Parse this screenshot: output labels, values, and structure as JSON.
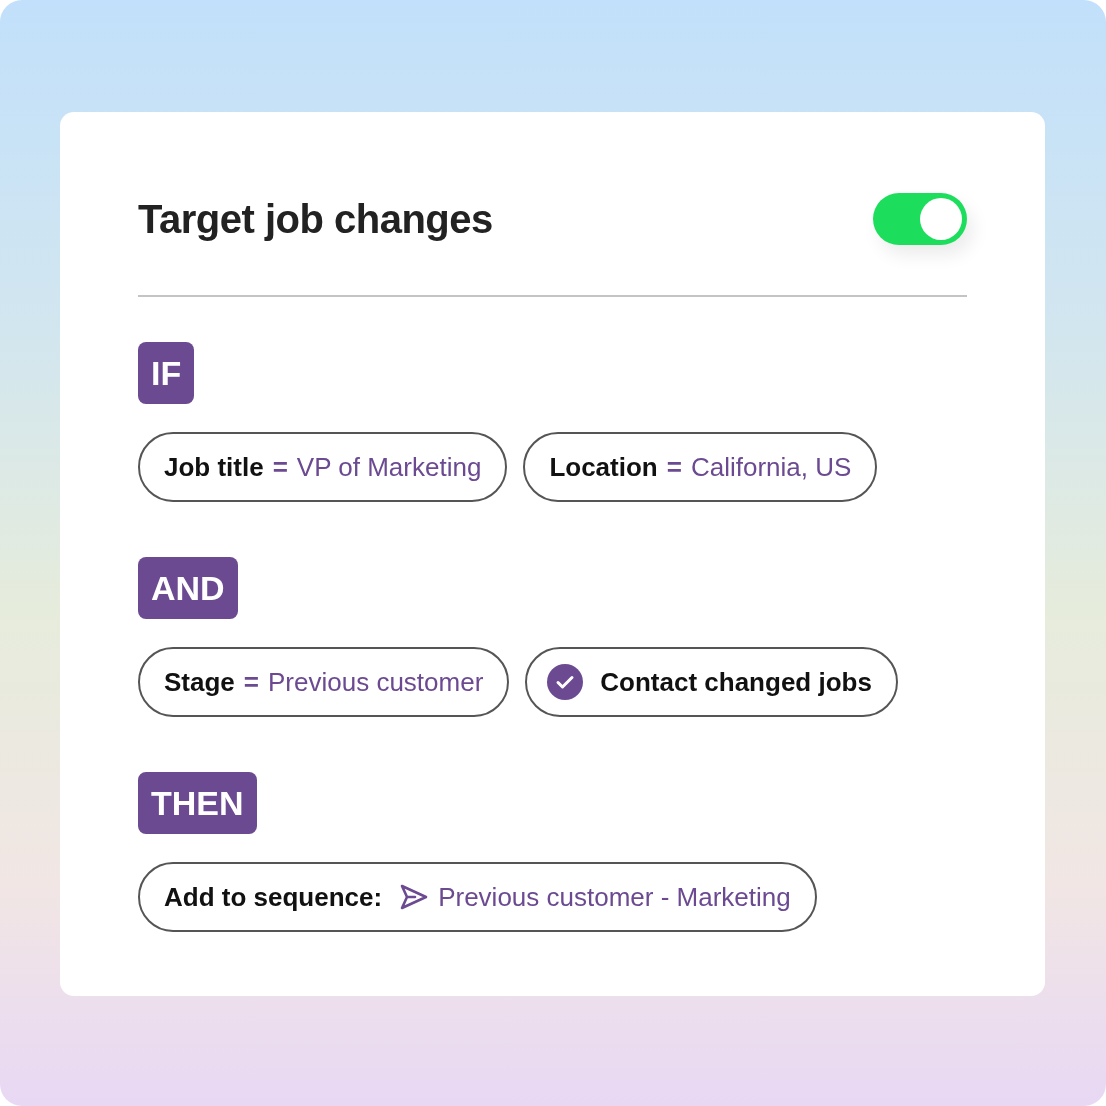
{
  "title": "Target job changes",
  "enabled": true,
  "sections": [
    {
      "label": "IF",
      "chips": [
        {
          "kind": "condition",
          "field": "Job title",
          "operator": "=",
          "value": "VP of Marketing"
        },
        {
          "kind": "condition",
          "field": "Location",
          "operator": "=",
          "value": "California, US"
        }
      ]
    },
    {
      "label": "AND",
      "chips": [
        {
          "kind": "condition",
          "field": "Stage",
          "operator": "=",
          "value": "Previous customer"
        },
        {
          "kind": "check",
          "field": "Contact changed jobs",
          "checked": true
        }
      ]
    },
    {
      "label": "THEN",
      "chips": [
        {
          "kind": "sequence",
          "field": "Add to sequence:",
          "value": "Previous customer - Marketing"
        }
      ]
    }
  ]
}
